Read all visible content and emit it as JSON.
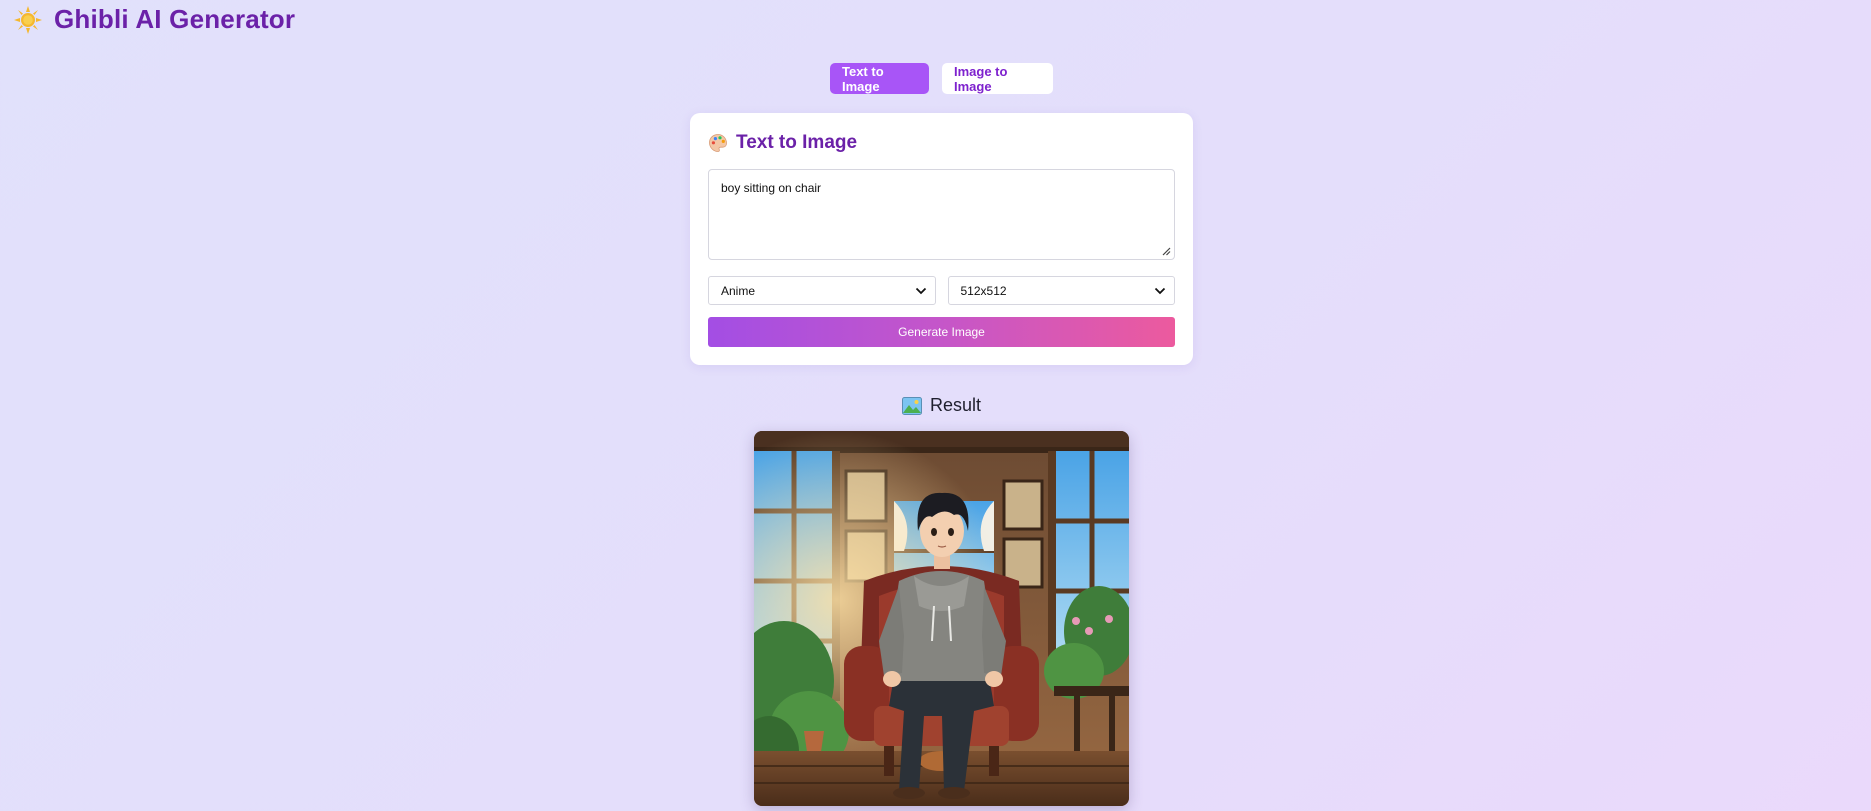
{
  "app": {
    "title": "Ghibli AI Generator",
    "logo_icon": "sun-icon"
  },
  "tabs": [
    {
      "label": "Text to Image",
      "active": true
    },
    {
      "label": "Image to Image",
      "active": false
    }
  ],
  "card": {
    "icon": "palette-icon",
    "title": "Text to Image",
    "prompt_value": "boy sitting on chair",
    "style_select": {
      "value": "Anime"
    },
    "size_select": {
      "value": "512x512"
    },
    "generate_label": "Generate Image"
  },
  "result": {
    "icon": "picture-icon",
    "title": "Result",
    "image_description_icon": "generated-image"
  },
  "colors": {
    "accent": "#a855f7",
    "title_purple": "#6b21a8",
    "gradient_start": "#a34ee4",
    "gradient_end": "#ec5a9e"
  }
}
